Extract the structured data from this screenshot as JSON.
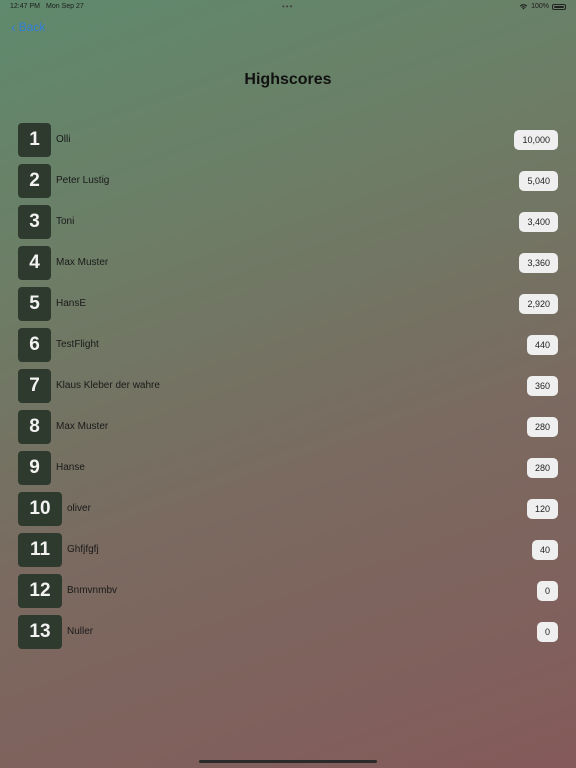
{
  "status_bar": {
    "time": "12:47 PM",
    "date": "Mon Sep 27",
    "dots": "•••",
    "battery_percent": "100%"
  },
  "nav": {
    "back_label": "Back"
  },
  "page": {
    "title": "Highscores"
  },
  "scores": [
    {
      "rank": "1",
      "name": "Olli",
      "score": "10,000"
    },
    {
      "rank": "2",
      "name": "Peter Lustig",
      "score": "5,040"
    },
    {
      "rank": "3",
      "name": "Toni",
      "score": "3,400"
    },
    {
      "rank": "4",
      "name": "Max Muster",
      "score": "3,360"
    },
    {
      "rank": "5",
      "name": "HansE",
      "score": "2,920"
    },
    {
      "rank": "6",
      "name": "TestFlight",
      "score": "440"
    },
    {
      "rank": "7",
      "name": "Klaus Kleber der wahre",
      "score": "360"
    },
    {
      "rank": "8",
      "name": "Max Muster",
      "score": "280"
    },
    {
      "rank": "9",
      "name": "Hanse",
      "score": "280"
    },
    {
      "rank": "10",
      "name": "oliver",
      "score": "120"
    },
    {
      "rank": "11",
      "name": "Ghfjfgfj",
      "score": "40"
    },
    {
      "rank": "12",
      "name": "Bnmvnmbv",
      "score": "0"
    },
    {
      "rank": "13",
      "name": "Nuller",
      "score": "0"
    }
  ]
}
